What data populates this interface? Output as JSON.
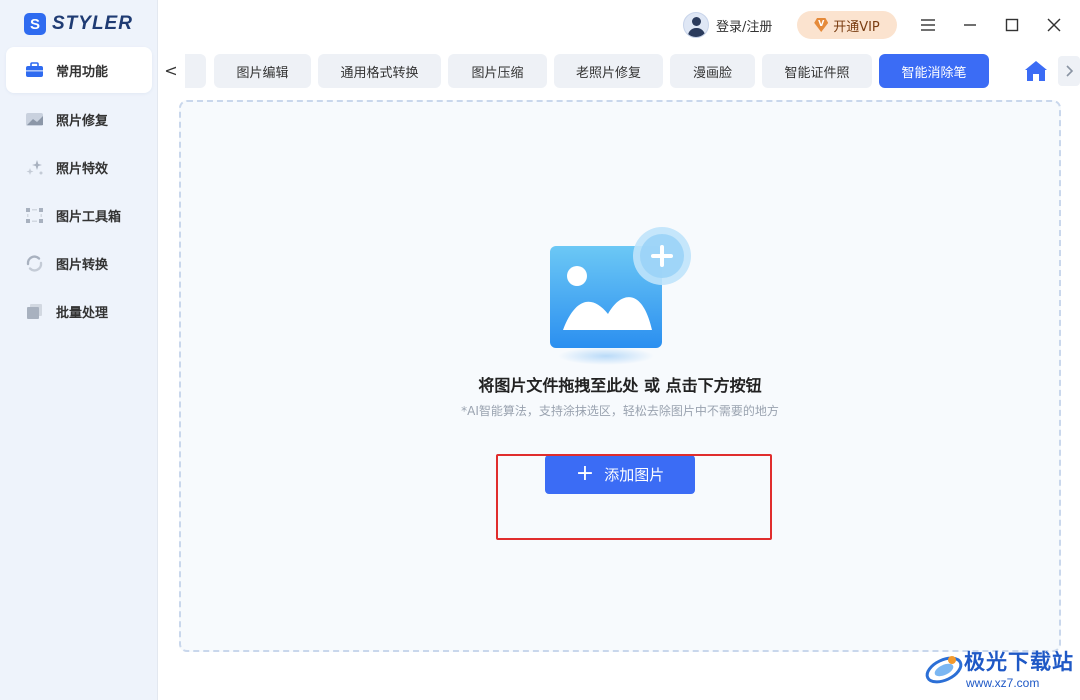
{
  "app": {
    "logo_letter": "S",
    "name": "STYLER"
  },
  "sidebar": {
    "items": [
      {
        "label": "常用功能",
        "icon": "toolbox-icon",
        "active": true
      },
      {
        "label": "照片修复",
        "icon": "photo-repair-icon"
      },
      {
        "label": "照片特效",
        "icon": "sparkle-icon"
      },
      {
        "label": "图片工具箱",
        "icon": "crop-frame-icon"
      },
      {
        "label": "图片转换",
        "icon": "convert-cycle-icon"
      },
      {
        "label": "批量处理",
        "icon": "stack-icon"
      }
    ]
  },
  "titlebar": {
    "login_label": "登录/注册",
    "vip_label": "开通VIP",
    "vip_badge": "V",
    "controls": [
      "menu-icon",
      "minimize-icon",
      "maximize-icon",
      "close-icon"
    ]
  },
  "tabs": {
    "items": [
      {
        "label": "图片编辑"
      },
      {
        "label": "通用格式转换"
      },
      {
        "label": "图片压缩"
      },
      {
        "label": "老照片修复"
      },
      {
        "label": "漫画脸"
      },
      {
        "label": "智能证件照"
      },
      {
        "label": "智能消除笔",
        "active": true
      }
    ],
    "prev_glyph": "<",
    "next_glyph": ">"
  },
  "dropzone": {
    "title": "将图片文件拖拽至此处 或 点击下方按钮",
    "subtitle": "*AI智能算法，支持涂抹选区，轻松去除图片中不需要的地方",
    "button_plus": "+",
    "button_label": "添加图片"
  },
  "watermark": {
    "title": "极光下载站",
    "url": "www.xz7.com"
  },
  "colors": {
    "accent": "#3b6cf5",
    "sidebar_bg": "#eef3fb",
    "highlight": "#e02d2d",
    "vip_bg": "#fbe3cf"
  }
}
